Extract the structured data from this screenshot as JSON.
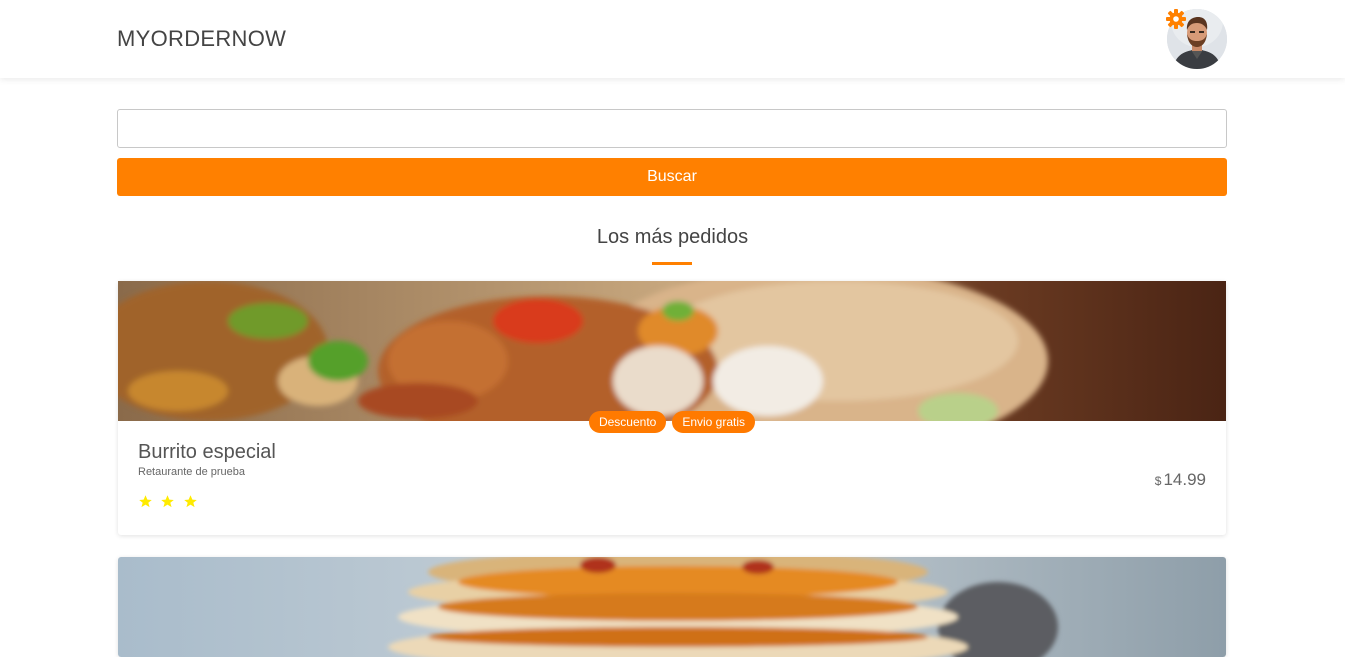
{
  "header": {
    "brand": "MYORDERNOW",
    "settings_icon": "gear-icon",
    "avatar_icon": "user-avatar"
  },
  "search": {
    "value": "",
    "placeholder": "",
    "button_label": "Buscar"
  },
  "section": {
    "title": "Los más pedidos"
  },
  "colors": {
    "accent": "#ff8000",
    "star": "#ffeb00"
  },
  "items": [
    {
      "name": "Burrito especial",
      "restaurant": "Retaurante de prueba",
      "tags": [
        "Descuento",
        "Envio gratis"
      ],
      "rating": 3,
      "currency": "$",
      "price": "14.99"
    },
    {
      "name": "",
      "restaurant": "",
      "tags": [],
      "rating": 0,
      "currency": "",
      "price": ""
    }
  ]
}
